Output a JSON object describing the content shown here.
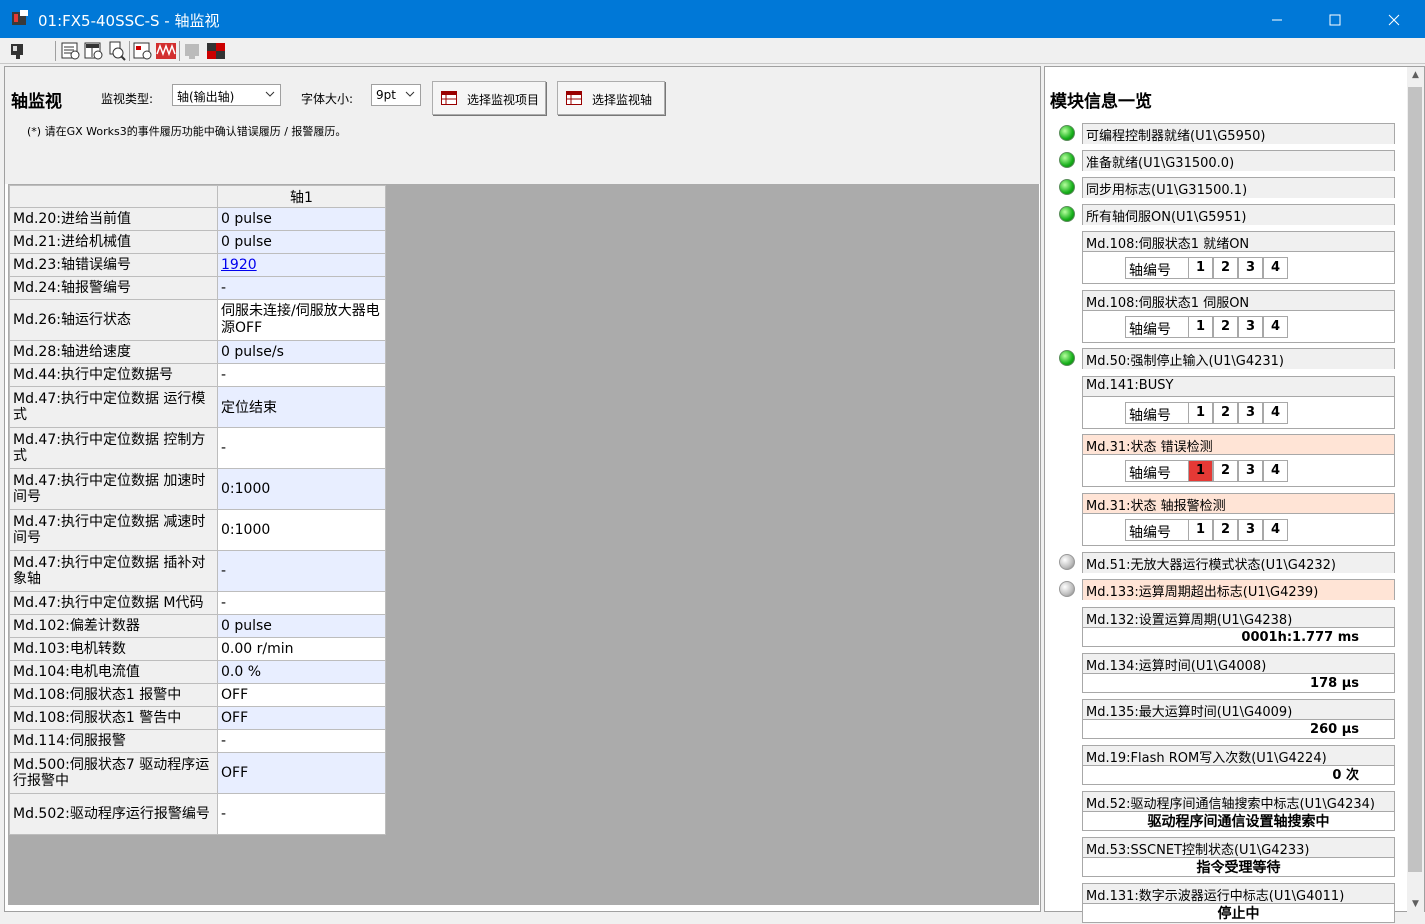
{
  "window": {
    "title": "01:FX5-40SSC-S - 轴监视"
  },
  "toolbar": {
    "icons": [
      "monitor-icon",
      "list-search-icon",
      "table-search-icon",
      "zoom-search-icon",
      "device-search-icon",
      "waveform-icon",
      "disabled-icon",
      "stop-icon"
    ]
  },
  "left": {
    "title": "轴监视",
    "monitor_type_label": "监视类型:",
    "monitor_type_value": "轴(输出轴)",
    "font_size_label": "字体大小:",
    "font_size_value": "9pt",
    "select_items_button": "选择监视项目",
    "select_axis_button": "选择监视轴",
    "note": "(*) 请在GX Works3的事件履历功能中确认错误履历 / 报警履历。",
    "table": {
      "column_header": "轴1",
      "rows": [
        {
          "key": "Md.20:进给当前值",
          "value": "0 pulse"
        },
        {
          "key": "Md.21:进给机械值",
          "value": "0 pulse"
        },
        {
          "key": "Md.23:轴错误编号",
          "value": "1920"
        },
        {
          "key": "Md.24:轴报警编号",
          "value": "-"
        },
        {
          "key": "Md.26:轴运行状态",
          "value": "伺服未连接/伺服放大器电源OFF"
        },
        {
          "key": "Md.28:轴进给速度",
          "value": "0 pulse/s"
        },
        {
          "key": "Md.44:执行中定位数据号",
          "value": "-"
        },
        {
          "key": "Md.47:执行中定位数据 运行模式",
          "value": "定位结束"
        },
        {
          "key": "Md.47:执行中定位数据 控制方式",
          "value": "-"
        },
        {
          "key": "Md.47:执行中定位数据 加速时间号",
          "value": "0:1000"
        },
        {
          "key": "Md.47:执行中定位数据 减速时间号",
          "value": "0:1000"
        },
        {
          "key": "Md.47:执行中定位数据 插补对象轴",
          "value": "-"
        },
        {
          "key": "Md.47:执行中定位数据 M代码",
          "value": "-"
        },
        {
          "key": "Md.102:偏差计数器",
          "value": "0 pulse"
        },
        {
          "key": "Md.103:电机转数",
          "value": "0.00 r/min"
        },
        {
          "key": "Md.104:电机电流值",
          "value": "0.0 %"
        },
        {
          "key": "Md.108:伺服状态1 报警中",
          "value": "OFF"
        },
        {
          "key": "Md.108:伺服状态1 警告中",
          "value": "OFF"
        },
        {
          "key": "Md.114:伺服报警",
          "value": "-"
        },
        {
          "key": "Md.500:伺服状态7 驱动程序运行报警中",
          "value": "OFF"
        },
        {
          "key": "Md.502:驱动程序运行报警编号",
          "value": "-"
        }
      ]
    }
  },
  "right": {
    "title": "模块信息一览",
    "axis_label": "轴编号",
    "axes": [
      "1",
      "2",
      "3",
      "4"
    ],
    "status": [
      {
        "label": "可编程控制器就绪(U1\\G5950)"
      },
      {
        "label": "准备就绪(U1\\G31500.0)"
      },
      {
        "label": "同步用标志(U1\\G31500.1)"
      },
      {
        "label": "所有轴伺服ON(U1\\G5951)"
      }
    ],
    "md108_ready": "Md.108:伺服状态1 就绪ON",
    "md108_servo": "Md.108:伺服状态1 伺服ON",
    "md50": "Md.50:强制停止输入(U1\\G4231)",
    "md141": "Md.141:BUSY",
    "md31_error": "Md.31:状态 错误检测",
    "md31_warn": "Md.31:状态 轴报警检测",
    "md51": "Md.51:无放大器运行模式状态(U1\\G4232)",
    "md133": "Md.133:运算周期超出标志(U1\\G4239)",
    "md132": {
      "label": "Md.132:设置运算周期(U1\\G4238)",
      "value": "0001h:1.777 ms"
    },
    "md134": {
      "label": "Md.134:运算时间(U1\\G4008)",
      "value": "178 μs"
    },
    "md135": {
      "label": "Md.135:最大运算时间(U1\\G4009)",
      "value": "260 μs"
    },
    "md19": {
      "label": "Md.19:Flash ROM写入次数(U1\\G4224)",
      "value": "0 次"
    },
    "md52": {
      "label": "Md.52:驱动程序间通信轴搜索中标志(U1\\G4234)",
      "value": "驱动程序间通信设置轴搜索中"
    },
    "md53": {
      "label": "Md.53:SSCNET控制状态(U1\\G4233)",
      "value": "指令受理等待"
    },
    "md131": {
      "label": "Md.131:数字示波器运行中标志(U1\\G4011)",
      "value": "停止中"
    }
  },
  "colors": {
    "title_bar": "#0078d7",
    "led_on": "#17b01b",
    "error_axis": "#e53935",
    "highlight_row": "#ffe4d6",
    "value_cell": "#e8eeff"
  }
}
